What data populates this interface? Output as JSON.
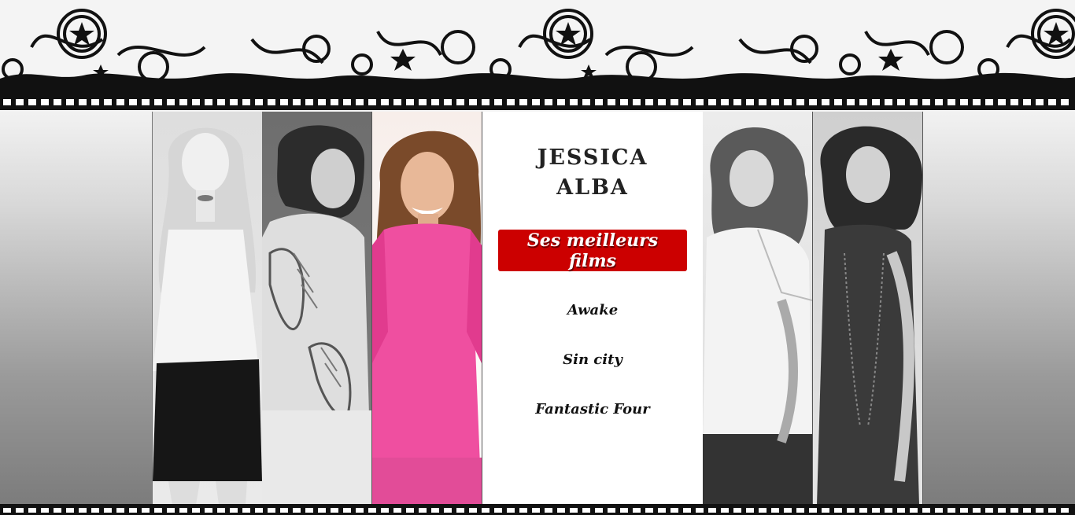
{
  "header": {
    "banner": "film-strip-star-banner"
  },
  "gallery": {
    "photos": [
      "actress-photo-1",
      "actress-photo-2",
      "actress-photo-3",
      "actress-photo-5",
      "actress-photo-6"
    ]
  },
  "card": {
    "title": "JESSICA ALBA",
    "button_label": "Ses meilleurs films",
    "films": [
      "Awake",
      "Sin city",
      "Fantastic Four"
    ]
  },
  "colors": {
    "accent": "#cc0000",
    "card_bg": "#ffffff",
    "film_strip": "#111111"
  }
}
